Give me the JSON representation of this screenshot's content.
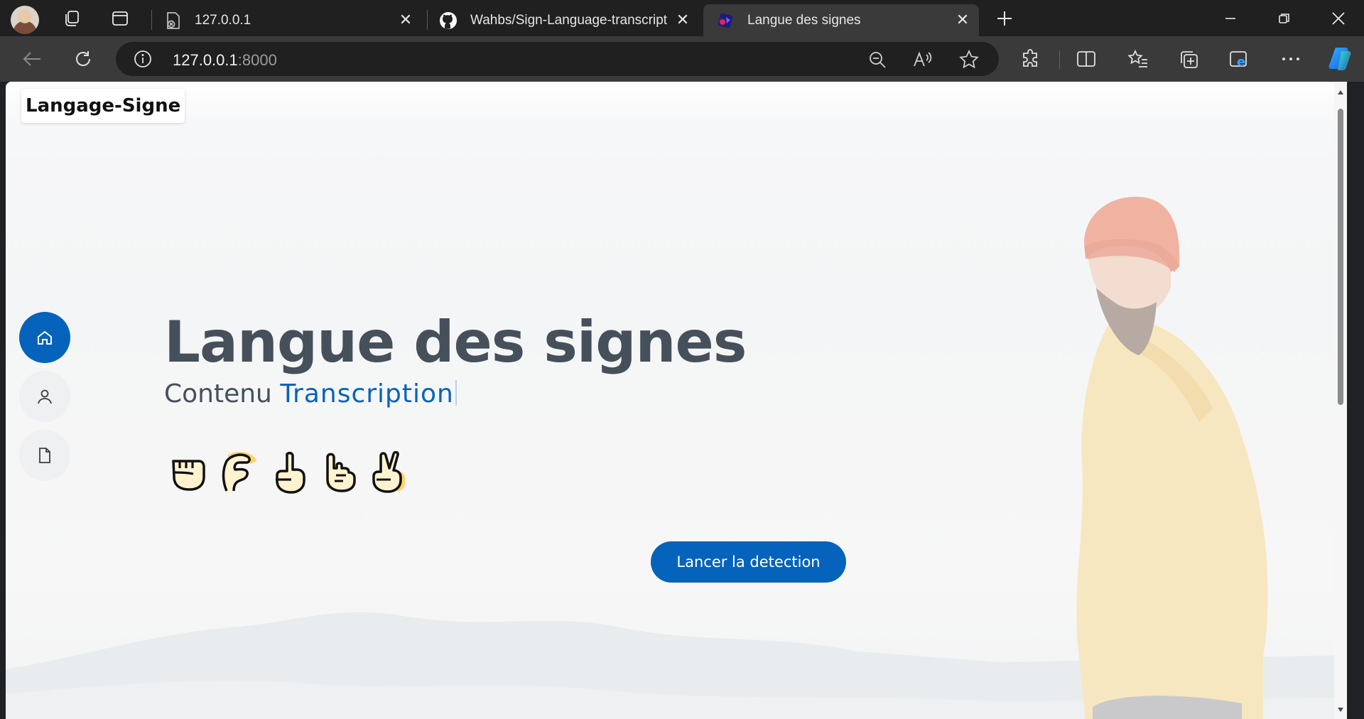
{
  "browser": {
    "tabs": [
      {
        "title": "127.0.0.1",
        "favicon": "broken-page-icon",
        "active": false
      },
      {
        "title": "Wahbs/Sign-Language-transcript",
        "favicon": "github-icon",
        "active": false
      },
      {
        "title": "Langue des signes",
        "favicon": "site-logo-icon",
        "active": true
      }
    ],
    "address": {
      "host": "127.0.0.1",
      "port": ":8000"
    }
  },
  "page": {
    "brand": "Langage-Signe",
    "hero": {
      "title": "Langue des signes",
      "subtitle_prefix": "Contenu",
      "subtitle_accent": "Transcription"
    },
    "side_nav": [
      {
        "icon": "home-icon",
        "active": true
      },
      {
        "icon": "user-icon",
        "active": false
      },
      {
        "icon": "document-icon",
        "active": false
      }
    ],
    "sign_icons": [
      "fist-hand-icon",
      "c-hand-icon",
      "pointing-up-hand-icon",
      "three-fingers-hand-icon",
      "victory-hand-icon"
    ],
    "cta_label": "Lancer la detection"
  },
  "colors": {
    "accent": "#0563bb",
    "heading": "#45505b",
    "hand_fill": "#ffd36b"
  }
}
